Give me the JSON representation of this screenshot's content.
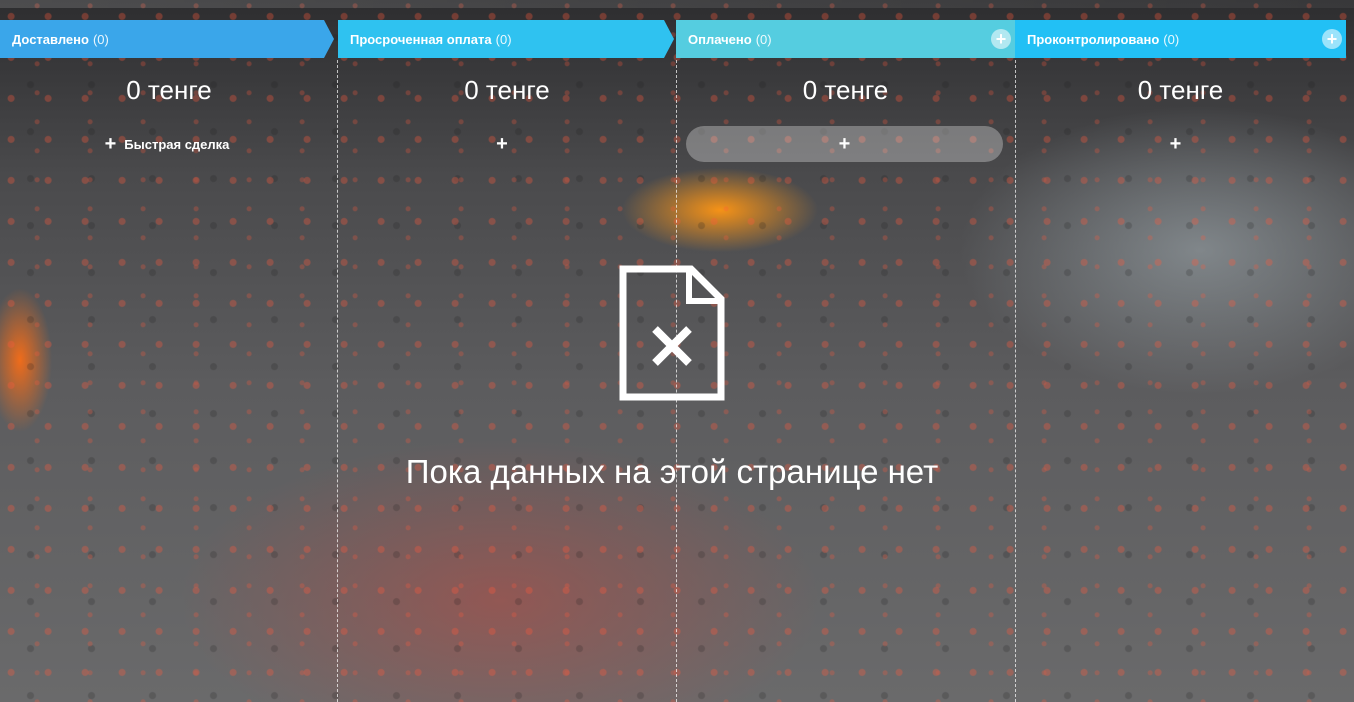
{
  "stages": [
    {
      "title": "Доставлено",
      "count": "(0)",
      "sum": "0 тенге",
      "quick_label": "Быстрая сделка",
      "color": "#3aa6ea"
    },
    {
      "title": "Просроченная оплата",
      "count": "(0)",
      "sum": "0 тенге",
      "quick_label": "",
      "color": "#2fc2f0"
    },
    {
      "title": "Оплачено",
      "count": "(0)",
      "sum": "0 тенге",
      "quick_label": "",
      "color": "#55cde0"
    },
    {
      "title": "Проконтролировано",
      "count": "(0)",
      "sum": "0 тенге",
      "quick_label": "",
      "color": "#22c0f5"
    }
  ],
  "plus_glyph": "+",
  "add_glyph": "+",
  "empty_state": {
    "icon": "document-x-icon",
    "text": "Пока данных на этой странице нет"
  }
}
